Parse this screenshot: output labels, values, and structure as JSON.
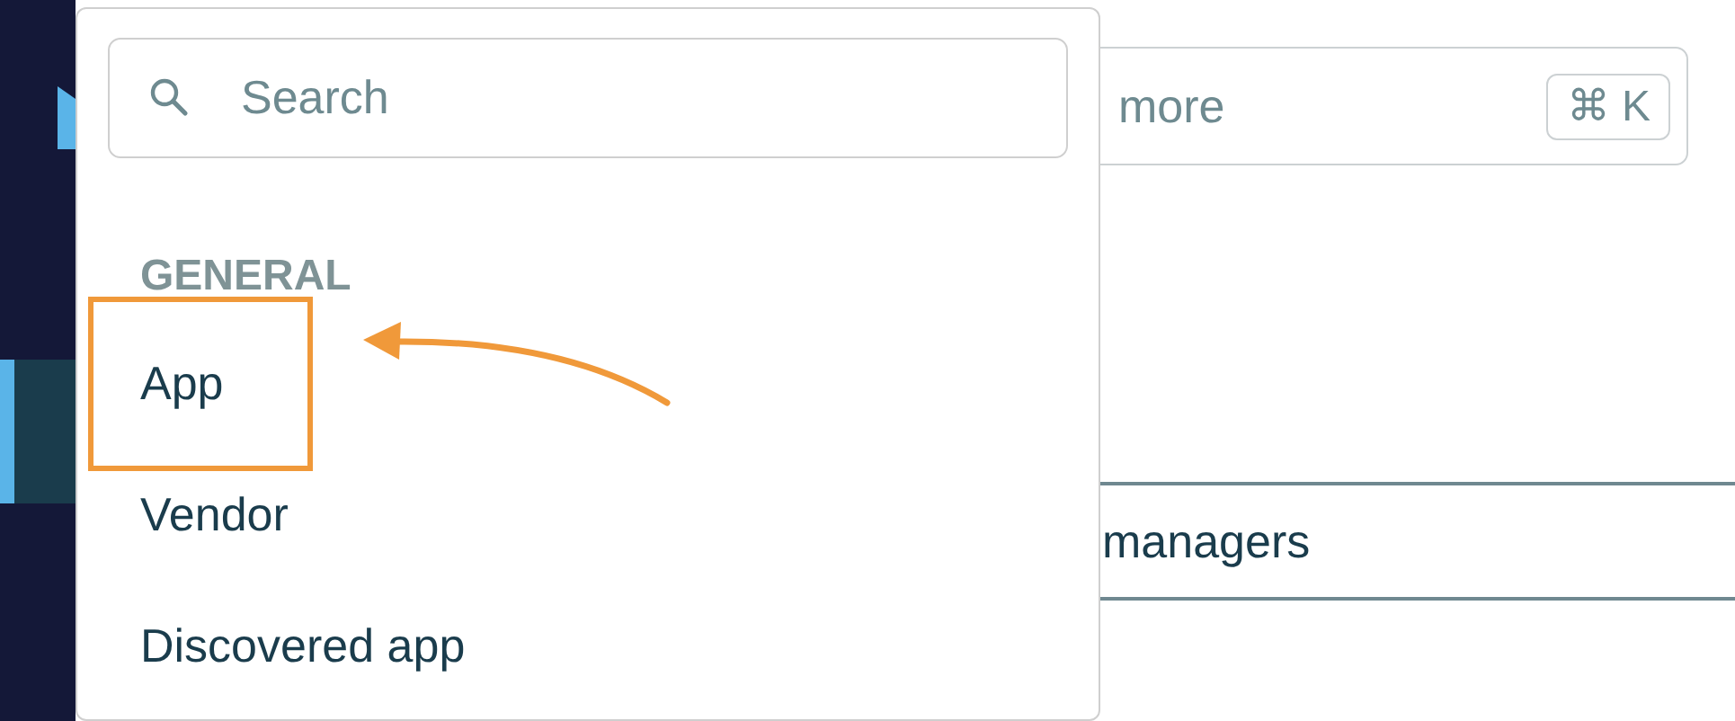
{
  "sidebar": {
    "items": [
      {
        "selected": true
      }
    ]
  },
  "header_search": {
    "placeholder": "more",
    "shortcut": "⌘ K"
  },
  "table": {
    "rows": [
      {
        "cell": "managers"
      }
    ]
  },
  "dropdown": {
    "search": {
      "placeholder": "Search"
    },
    "sections": [
      {
        "heading": "GENERAL",
        "items": [
          {
            "label": "App",
            "highlighted": true
          },
          {
            "label": "Vendor",
            "highlighted": false
          },
          {
            "label": "Discovered app",
            "highlighted": false
          }
        ]
      }
    ]
  }
}
